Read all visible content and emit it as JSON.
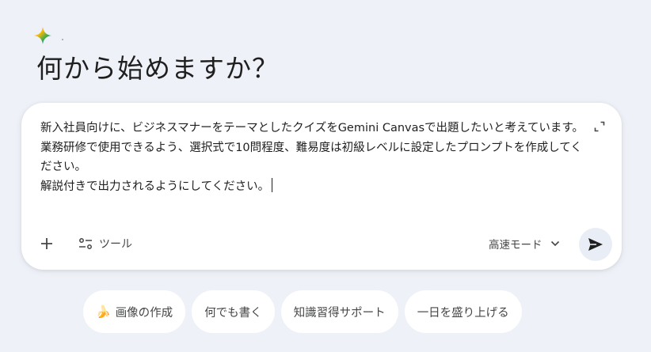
{
  "greeting": "何から始めますか？",
  "composer": {
    "prompt_line_1": "新入社員向けに、ビジネスマナーをテーマとしたクイズをGemini Canvasで出題したいと考えています。",
    "prompt_line_2": "業務研修で使用できるよう、選択式で10問程度、難易度は初級レベルに設定したプロンプトを作成してください。",
    "prompt_line_3": "解説付きで出力されるようにしてください。",
    "tools_label": "ツール",
    "mode_label": "高速モード"
  },
  "suggestions": [
    {
      "label": "画像の作成",
      "icon": "banana-icon"
    },
    {
      "label": "何でも書く"
    },
    {
      "label": "知識習得サポート"
    },
    {
      "label": "一日を盛り上げる"
    }
  ],
  "colors": {
    "background": "#eef1f7",
    "send_button": "#e9eef6",
    "sparkle_blue": "#4285f4",
    "sparkle_red": "#ea4335",
    "sparkle_yellow": "#fbbc04",
    "sparkle_green": "#34a853"
  }
}
